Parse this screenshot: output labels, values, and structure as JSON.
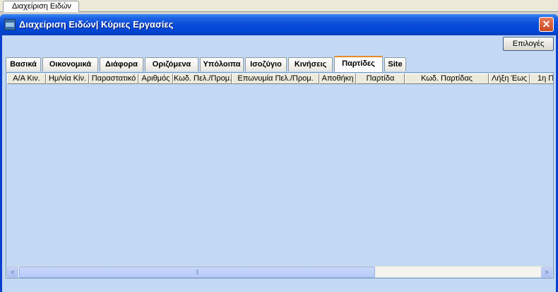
{
  "document_tab": {
    "label": "Διαχείριση Ειδών"
  },
  "window": {
    "title": "Διαχείριση Ειδών| Κύριες Εργασίες",
    "close_symbol": "✕"
  },
  "toolbar": {
    "options_label": "Επιλογές"
  },
  "tabs": [
    {
      "label": "Βασικά"
    },
    {
      "label": "Οικονομικά"
    },
    {
      "label": "Διάφορα"
    },
    {
      "label": "Οριζόμενα"
    },
    {
      "label": "Υπόλοιπα"
    },
    {
      "label": "Ισοζύγιο"
    },
    {
      "label": "Κινήσεις"
    },
    {
      "label": "Παρτίδες",
      "active": true
    },
    {
      "label": "Site"
    }
  ],
  "grid": {
    "columns": [
      "Α/Α Κιν.",
      "Ημ/νία Κίν.",
      "Παραστατικό",
      "Αριθμός",
      "Κωδ. Πελ./Προμ.",
      "Επωνυμία Πελ./Προμ.",
      "Αποθήκη",
      "Παρτίδα",
      "Κωδ. Παρτίδας",
      "Λήξη Έως",
      "1η Π"
    ],
    "rows": []
  },
  "scrollbar": {
    "left_arrow": "<",
    "right_arrow": ">",
    "grip": "|||"
  }
}
